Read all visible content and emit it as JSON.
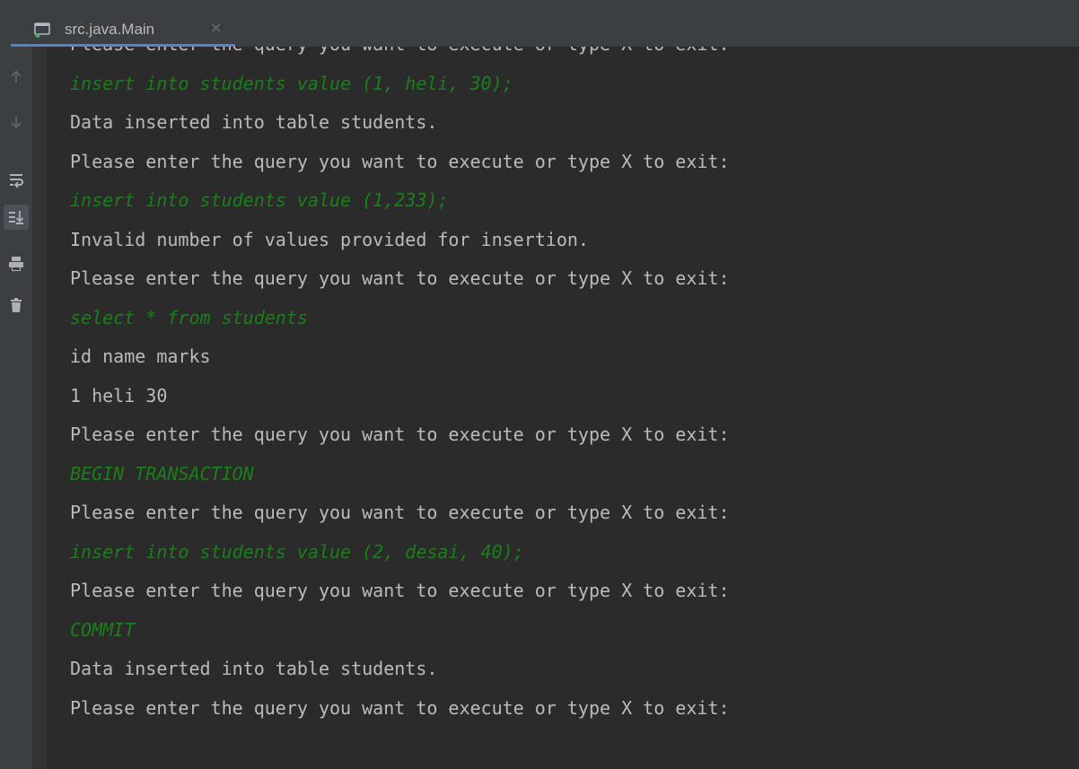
{
  "tab": {
    "title": "src.java.Main",
    "close_glyph": "×"
  },
  "toolbar": [
    {
      "name": "up-arrow-icon"
    },
    {
      "name": "down-arrow-icon"
    },
    {
      "name": "soft-wrap-icon"
    },
    {
      "name": "scroll-to-end-icon"
    },
    {
      "name": "print-icon"
    },
    {
      "name": "trash-icon"
    }
  ],
  "colors": {
    "background": "#2b2b2b",
    "output_text": "#bbbbbb",
    "input_text": "#1a7f1a",
    "tab_underline": "#4a88c7"
  },
  "console": {
    "lines": [
      {
        "kind": "output",
        "text": "Please enter the query you want to execute or type X to exit:"
      },
      {
        "kind": "input",
        "text": "insert into students value (1, heli, 30);"
      },
      {
        "kind": "output",
        "text": "Data inserted into table students."
      },
      {
        "kind": "output",
        "text": "Please enter the query you want to execute or type X to exit:"
      },
      {
        "kind": "input",
        "text": "insert into students value (1,233);"
      },
      {
        "kind": "output",
        "text": "Invalid number of values provided for insertion."
      },
      {
        "kind": "output",
        "text": "Please enter the query you want to execute or type X to exit:"
      },
      {
        "kind": "input",
        "text": "select * from students"
      },
      {
        "kind": "output",
        "text": "id name marks"
      },
      {
        "kind": "output",
        "text": "1 heli 30"
      },
      {
        "kind": "output",
        "text": "Please enter the query you want to execute or type X to exit:"
      },
      {
        "kind": "input",
        "text": "BEGIN TRANSACTION"
      },
      {
        "kind": "output",
        "text": "Please enter the query you want to execute or type X to exit:"
      },
      {
        "kind": "input",
        "text": "insert into students value (2, desai, 40);"
      },
      {
        "kind": "output",
        "text": "Please enter the query you want to execute or type X to exit:"
      },
      {
        "kind": "input",
        "text": "COMMIT"
      },
      {
        "kind": "output",
        "text": "Data inserted into table students."
      },
      {
        "kind": "output",
        "text": "Please enter the query you want to execute or type X to exit:"
      }
    ]
  }
}
